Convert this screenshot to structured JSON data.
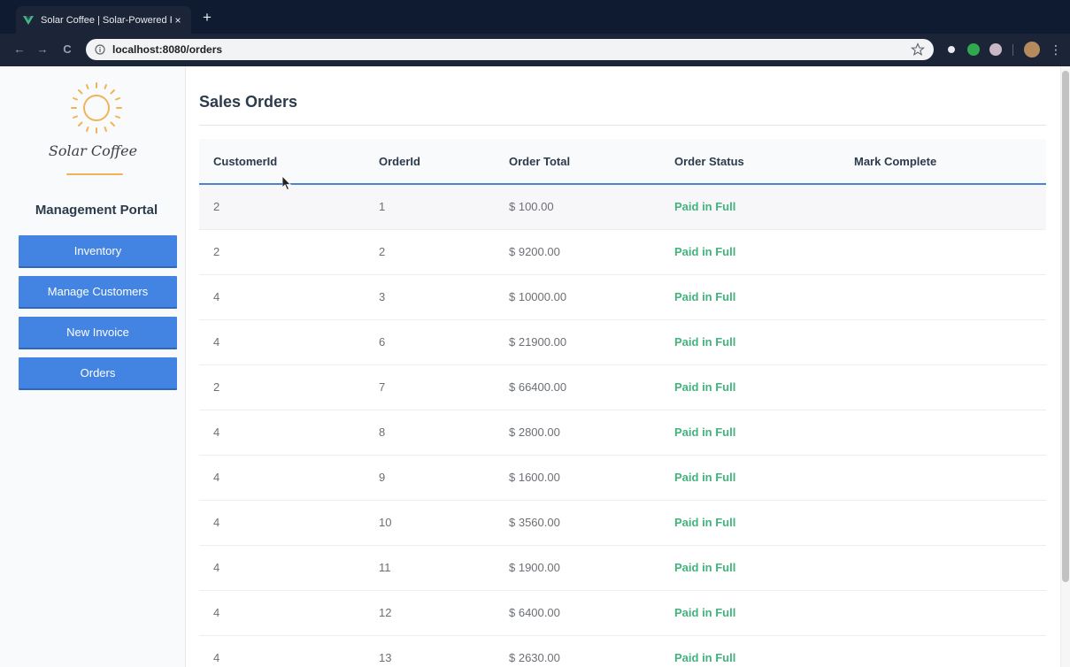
{
  "browser": {
    "tab_title": "Solar Coffee | Solar-Powered F",
    "close_glyph": "×",
    "new_tab_glyph": "+",
    "back_glyph": "←",
    "forward_glyph": "→",
    "reload_glyph": "C",
    "url": "localhost:8080/orders",
    "menu_glyph": "⋮"
  },
  "sidebar": {
    "brand": "Solar Coffee",
    "portal_title": "Management Portal",
    "nav": [
      {
        "label": "Inventory"
      },
      {
        "label": "Manage Customers"
      },
      {
        "label": "New Invoice"
      },
      {
        "label": "Orders"
      }
    ]
  },
  "main": {
    "title": "Sales Orders",
    "table": {
      "headers": [
        "CustomerId",
        "OrderId",
        "Order Total",
        "Order Status",
        "Mark Complete"
      ],
      "rows": [
        {
          "customer_id": "2",
          "order_id": "1",
          "total": "$ 100.00",
          "status": "Paid in Full"
        },
        {
          "customer_id": "2",
          "order_id": "2",
          "total": "$ 9200.00",
          "status": "Paid in Full"
        },
        {
          "customer_id": "4",
          "order_id": "3",
          "total": "$ 10000.00",
          "status": "Paid in Full"
        },
        {
          "customer_id": "4",
          "order_id": "6",
          "total": "$ 21900.00",
          "status": "Paid in Full"
        },
        {
          "customer_id": "2",
          "order_id": "7",
          "total": "$ 66400.00",
          "status": "Paid in Full"
        },
        {
          "customer_id": "4",
          "order_id": "8",
          "total": "$ 2800.00",
          "status": "Paid in Full"
        },
        {
          "customer_id": "4",
          "order_id": "9",
          "total": "$ 1600.00",
          "status": "Paid in Full"
        },
        {
          "customer_id": "4",
          "order_id": "10",
          "total": "$ 3560.00",
          "status": "Paid in Full"
        },
        {
          "customer_id": "4",
          "order_id": "11",
          "total": "$ 1900.00",
          "status": "Paid in Full"
        },
        {
          "customer_id": "4",
          "order_id": "12",
          "total": "$ 6400.00",
          "status": "Paid in Full"
        },
        {
          "customer_id": "4",
          "order_id": "13",
          "total": "$ 2630.00",
          "status": "Paid in Full"
        }
      ]
    }
  },
  "icons": {
    "tab_logo": "vue-logo-icon",
    "info": "info-icon",
    "bookmark": "star-icon",
    "brand_logo": "sun-icon",
    "cursor": "mouse-pointer-icon"
  },
  "colors": {
    "nav_button": "#4384e2",
    "status_paid": "#42b37d",
    "header_rule": "#4a84d6",
    "brand_accent": "#f0b458",
    "chrome_dark": "#0f1b30"
  }
}
